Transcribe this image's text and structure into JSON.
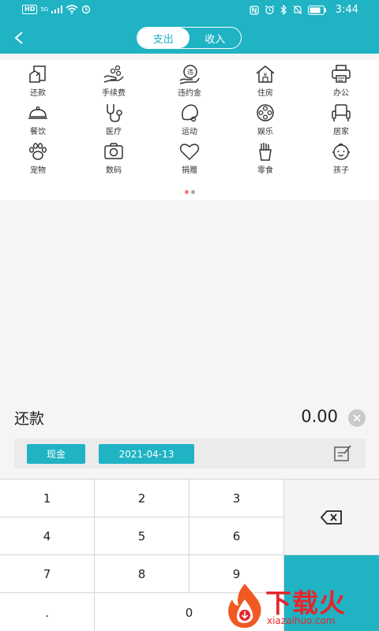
{
  "status_bar": {
    "hd": "HD",
    "net": "5G",
    "time": "3:44"
  },
  "header": {
    "tabs": [
      {
        "label": "支出",
        "active": true
      },
      {
        "label": "收入",
        "active": false
      }
    ]
  },
  "categories": [
    {
      "label": "还款",
      "icon": "repayment-icon"
    },
    {
      "label": "手续费",
      "icon": "fee-icon"
    },
    {
      "label": "违约金",
      "icon": "penalty-icon"
    },
    {
      "label": "住房",
      "icon": "house-icon"
    },
    {
      "label": "办公",
      "icon": "printer-icon"
    },
    {
      "label": "餐饮",
      "icon": "cloche-icon"
    },
    {
      "label": "医疗",
      "icon": "stethoscope-icon"
    },
    {
      "label": "运动",
      "icon": "sports-icon"
    },
    {
      "label": "娱乐",
      "icon": "film-reel-icon"
    },
    {
      "label": "居家",
      "icon": "armchair-icon"
    },
    {
      "label": "宠物",
      "icon": "paw-icon"
    },
    {
      "label": "数码",
      "icon": "camera-icon"
    },
    {
      "label": "捐赠",
      "icon": "heart-icon"
    },
    {
      "label": "零食",
      "icon": "fries-icon"
    },
    {
      "label": "孩子",
      "icon": "baby-icon"
    }
  ],
  "selected": {
    "category": "还款",
    "amount": "0.00"
  },
  "options": {
    "account": "现金",
    "date": "2021-04-13"
  },
  "keypad": {
    "keys": [
      "1",
      "2",
      "3",
      "4",
      "5",
      "6",
      "7",
      "8",
      "9",
      ".",
      "0"
    ]
  },
  "watermark": {
    "title": "下载火",
    "domain": "xiazaihuo.com"
  },
  "colors": {
    "accent": "#1fb3c4",
    "dot_active": "#f07d6b",
    "watermark": "#e5262a"
  }
}
